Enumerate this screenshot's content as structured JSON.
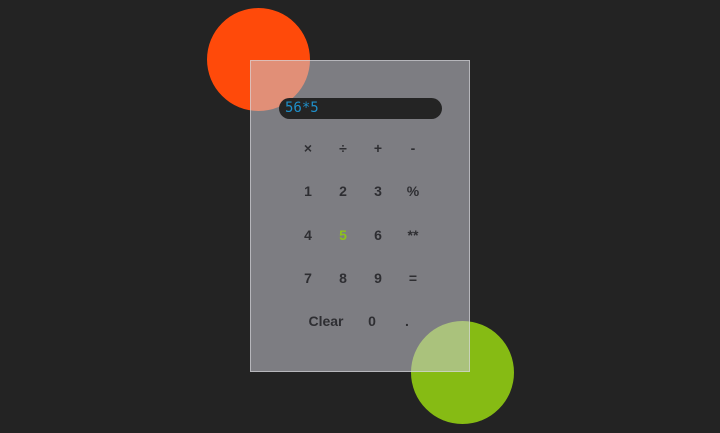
{
  "colors": {
    "background": "#232323",
    "orange_blob": "#ff4a0a",
    "green_blob": "#86bb14",
    "display_bg": "#242424",
    "display_text": "#1f8fc9",
    "key_text": "#2e2e32",
    "pressed_key_text": "#8dc21c"
  },
  "display": {
    "value": "56*5"
  },
  "keypad": {
    "rows": [
      [
        "×",
        "÷",
        "+",
        "-"
      ],
      [
        "1",
        "2",
        "3",
        "%"
      ],
      [
        "4",
        "5",
        "6",
        "**"
      ],
      [
        "7",
        "8",
        "9",
        "="
      ],
      [
        "Clear",
        "0",
        "."
      ]
    ],
    "highlighted_key": "5"
  }
}
